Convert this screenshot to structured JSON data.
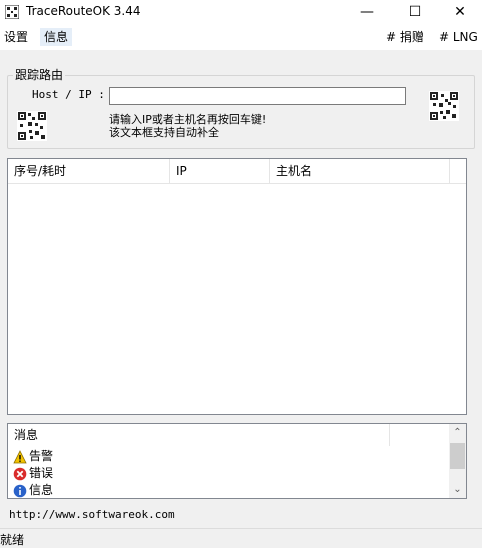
{
  "window": {
    "title": "TraceRouteOK 3.44",
    "controls": {
      "minimize": "—",
      "maximize": "☐",
      "close": "✕"
    }
  },
  "menubar": {
    "left": [
      "设置",
      "信息"
    ],
    "right": [
      "# 捐赠",
      "# LNG"
    ]
  },
  "trace_group": {
    "label": "跟踪路由",
    "host_label": "Host / IP :",
    "host_value": "",
    "hint_line1": "请输入IP或者主机名再按回车键!",
    "hint_line2": "该文本框支持自动补全"
  },
  "results_table": {
    "columns": [
      "序号/耗时",
      "IP",
      "主机名"
    ],
    "rows": []
  },
  "messages": {
    "header": "消息",
    "items": [
      {
        "icon": "warning-icon",
        "label": "告警",
        "color": "#f2c200"
      },
      {
        "icon": "error-icon",
        "label": "错误",
        "color": "#d92b2b"
      },
      {
        "icon": "info-icon",
        "label": "信息",
        "color": "#2a62c9"
      }
    ]
  },
  "footer": {
    "url": "http://www.softwareok.com",
    "status": "就绪"
  }
}
